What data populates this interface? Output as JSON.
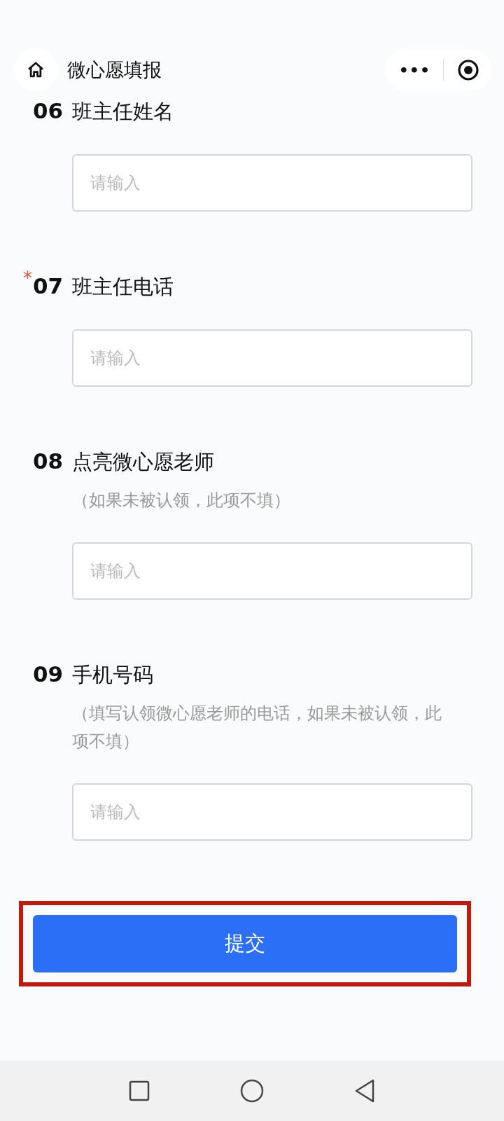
{
  "header": {
    "title": "微心愿填报",
    "menu_icon": "•••"
  },
  "questions": [
    {
      "number": "06",
      "title": "班主任姓名",
      "required": false,
      "placeholder": "请输入"
    },
    {
      "number": "07",
      "title": "班主任电话",
      "required": true,
      "placeholder": "请输入"
    },
    {
      "number": "08",
      "title": "点亮微心愿老师",
      "required": false,
      "note": "（如果未被认领，此项不填）",
      "placeholder": "请输入"
    },
    {
      "number": "09",
      "title": "手机号码",
      "required": false,
      "note": "（填写认领微心愿老师的电话，如果未被认领，此项不填）",
      "placeholder": "请输入"
    }
  ],
  "required_mark": "*",
  "submit": {
    "label": "提交",
    "highlighted": true
  }
}
